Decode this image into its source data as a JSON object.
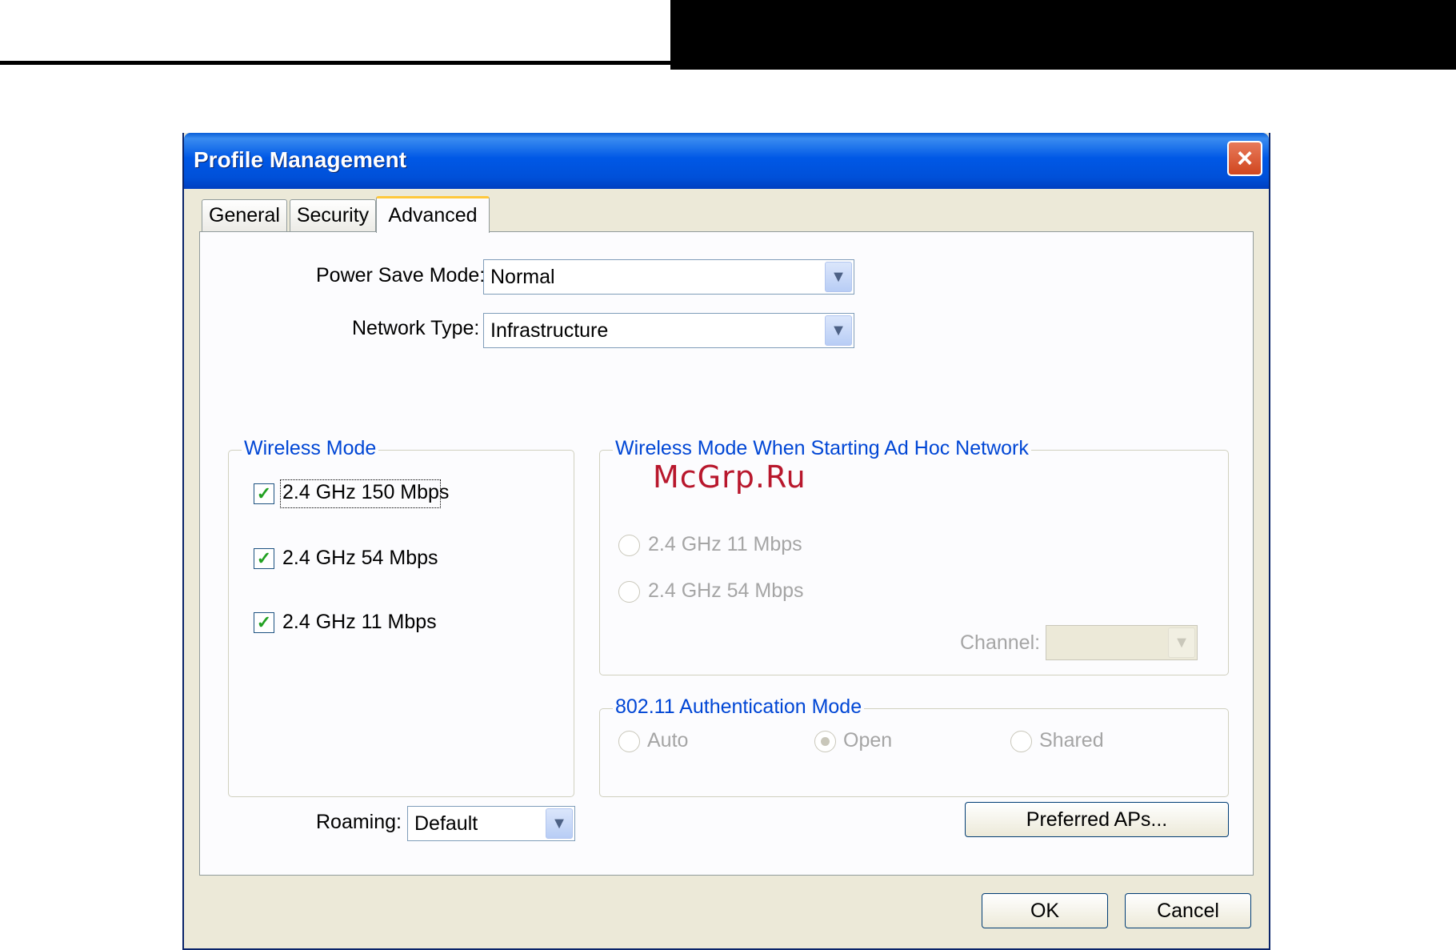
{
  "dialog": {
    "title": "Profile Management",
    "close_label": "×"
  },
  "tabs": [
    {
      "label": "General",
      "active": false
    },
    {
      "label": "Security",
      "active": false
    },
    {
      "label": "Advanced",
      "active": true
    }
  ],
  "advanced": {
    "power_save_mode": {
      "label": "Power Save Mode:",
      "value": "Normal"
    },
    "network_type": {
      "label": "Network Type:",
      "value": "Infrastructure"
    },
    "wireless_mode": {
      "title": "Wireless Mode",
      "options": [
        {
          "label": "2.4 GHz 150 Mbps",
          "checked": true
        },
        {
          "label": "2.4 GHz 54 Mbps",
          "checked": true
        },
        {
          "label": "2.4 GHz 11 Mbps",
          "checked": true
        }
      ]
    },
    "adhoc_mode": {
      "title": "Wireless Mode When Starting Ad Hoc Network",
      "options": [
        {
          "label": "2.4 GHz 11 Mbps",
          "checked": false
        },
        {
          "label": "2.4 GHz 54 Mbps",
          "checked": false
        }
      ],
      "channel_label": "Channel:",
      "channel_value": ""
    },
    "auth_mode": {
      "title": "802.11 Authentication Mode",
      "options": [
        {
          "label": "Auto",
          "checked": false
        },
        {
          "label": "Open",
          "checked": true
        },
        {
          "label": "Shared",
          "checked": false
        }
      ]
    },
    "roaming": {
      "label": "Roaming:",
      "value": "Default"
    },
    "preferred_aps_label": "Preferred APs..."
  },
  "buttons": {
    "ok": "OK",
    "cancel": "Cancel"
  },
  "watermark": "McGrp.Ru",
  "icons": {
    "dropdown": "chevron-down-icon",
    "check": "check-icon",
    "close": "close-icon"
  },
  "colors": {
    "title_bar": "#0058e6",
    "group_title": "#0046d5",
    "watermark": "#b8172c"
  }
}
